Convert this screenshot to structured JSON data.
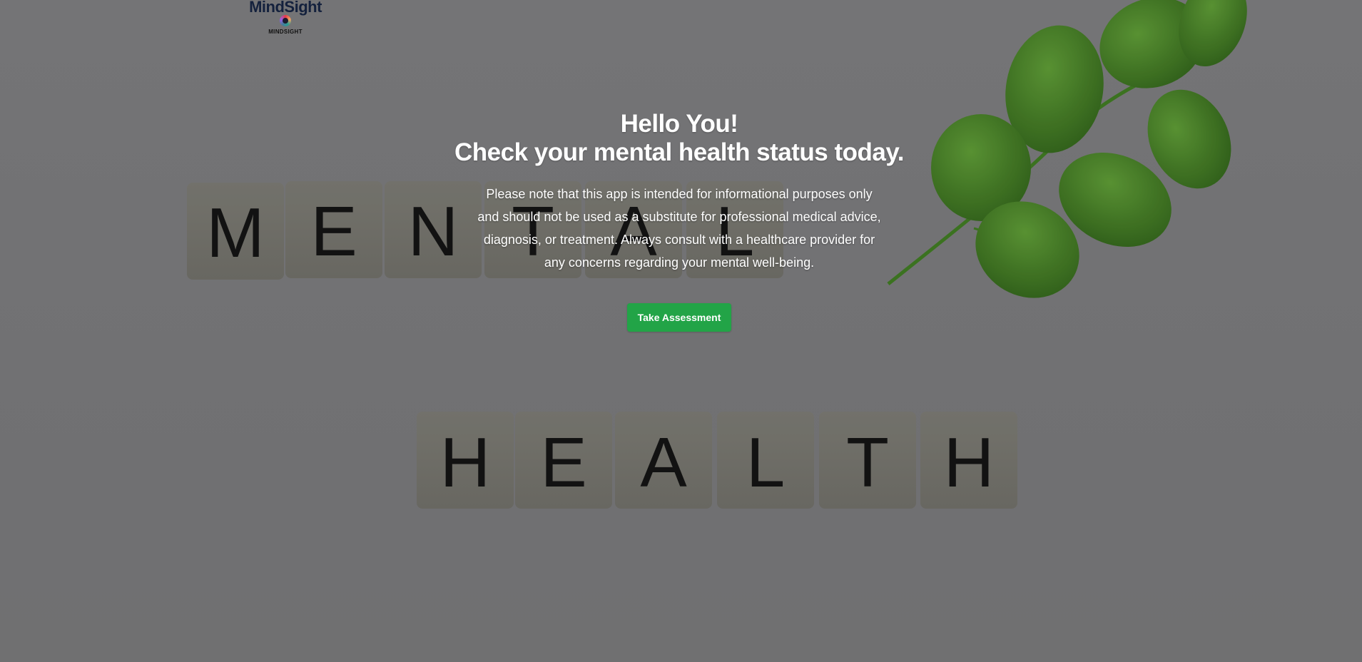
{
  "logo": {
    "wordmark": "MindSight",
    "subtitle": "MINDSIGHT"
  },
  "hero": {
    "title_line1": "Hello You!",
    "title_line2": "Check your mental health status today.",
    "disclaimer": "Please note that this app is intended for informational purposes only and should not be used as a substitute for professional medical advice, diagnosis, or treatment. Always consult with a healthcare provider for any concerns regarding your mental well-being.",
    "cta_label": "Take Assessment"
  },
  "background": {
    "tiles_row1": [
      "M",
      "E",
      "N",
      "T",
      "A",
      "L"
    ],
    "tiles_row2": [
      "H",
      "E",
      "A",
      "L",
      "T",
      "H"
    ]
  },
  "colors": {
    "cta": "#22a447",
    "text": "#ffffff",
    "tile": "#e9e6d6",
    "leaf": "#4e8a2c"
  }
}
